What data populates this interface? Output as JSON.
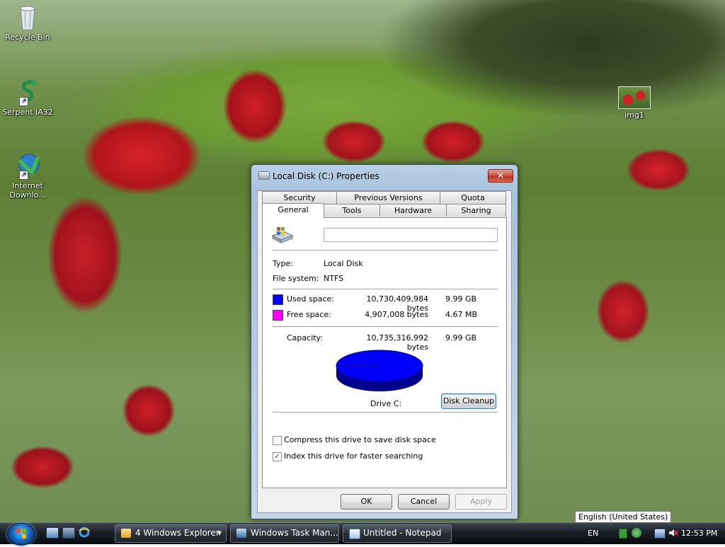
{
  "desktop": {
    "icons": [
      {
        "label": "Recycle Bin",
        "icon": "recycle-bin-icon"
      },
      {
        "label": "Serpent IA32",
        "icon": "serpent-icon"
      },
      {
        "label": "Internet Downlo...",
        "icon": "internet-download-icon"
      },
      {
        "label": "img1",
        "icon": "image-thumbnail-icon"
      }
    ]
  },
  "dialog": {
    "title": "Local Disk (C:) Properties",
    "close_glyph": "✕",
    "tabs_row1": [
      "Security",
      "Previous Versions",
      "Quota"
    ],
    "tabs_row2": [
      "General",
      "Tools",
      "Hardware",
      "Sharing"
    ],
    "active_tab": "General",
    "label_value": "",
    "type_label": "Type:",
    "type_value": "Local Disk",
    "fs_label": "File system:",
    "fs_value": "NTFS",
    "used_label": "Used space:",
    "used_bytes": "10,730,409,984 bytes",
    "used_size": "9.99 GB",
    "free_label": "Free space:",
    "free_bytes": "4,907,008 bytes",
    "free_size": "4.67 MB",
    "capacity_label": "Capacity:",
    "capacity_bytes": "10,735,316,992 bytes",
    "capacity_size": "9.99 GB",
    "drive_label": "Drive C:",
    "disk_cleanup_label": "Disk Cleanup",
    "compress_label": "Compress this drive to save disk space",
    "compress_checked": false,
    "index_label": "Index this drive for faster searching",
    "index_checked": true,
    "check_glyph": "✓",
    "ok_label": "OK",
    "cancel_label": "Cancel",
    "apply_label": "Apply",
    "colors": {
      "used": "#0000ff",
      "free": "#ff00ff"
    },
    "used_fraction": 0.9995
  },
  "taskbar": {
    "tasks": [
      {
        "label": "4 Windows Explorer",
        "icon": "folder-icon",
        "arrow": "▾"
      },
      {
        "label": "Windows Task Man...",
        "icon": "task-manager-icon"
      },
      {
        "label": "Untitled - Notepad",
        "icon": "notepad-icon"
      }
    ],
    "tray": {
      "language": "EN",
      "tooltip": "English (United States)",
      "time": "12:53 PM"
    }
  }
}
